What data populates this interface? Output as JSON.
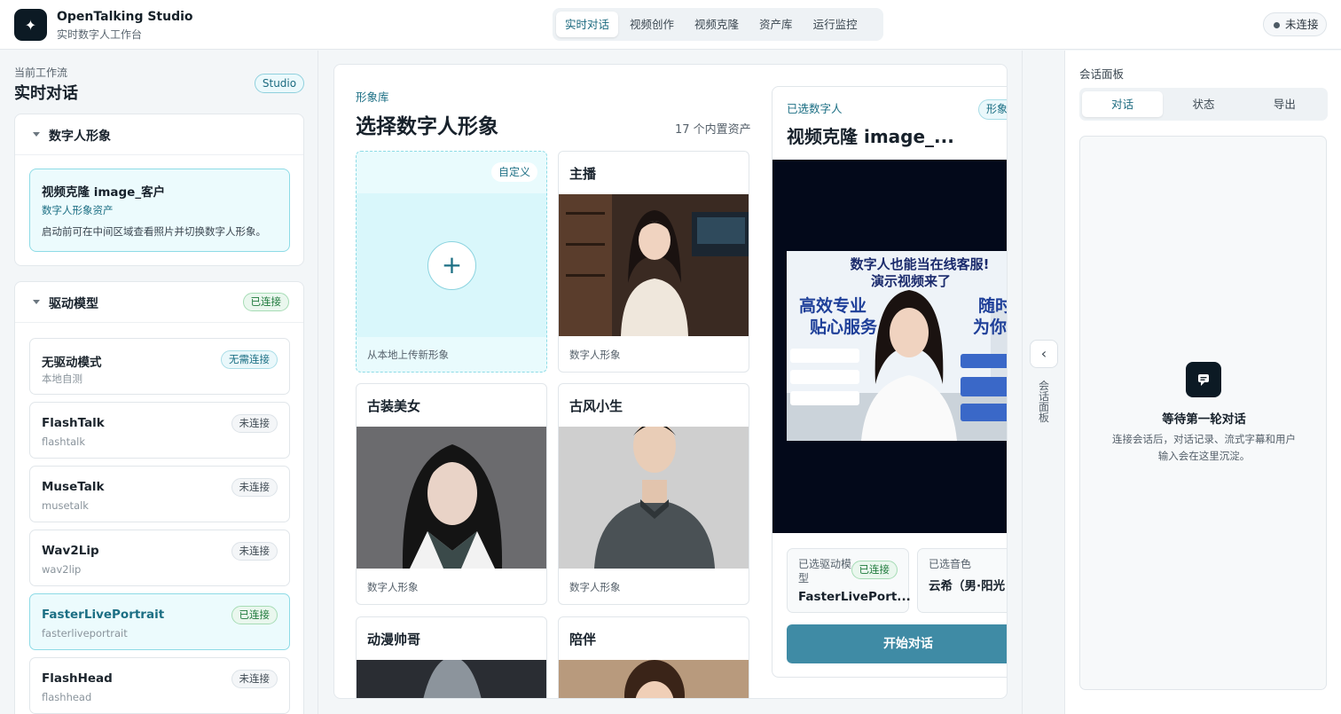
{
  "header": {
    "app_title": "OpenTalking Studio",
    "app_subtitle": "实时数字人工作台",
    "nav": [
      "实时对话",
      "视频创作",
      "视频克隆",
      "资产库",
      "运行监控"
    ],
    "active_nav": "实时对话",
    "connection_status": "未连接"
  },
  "left_panel": {
    "workflow_label": "当前工作流",
    "workflow_title": "实时对话",
    "workflow_badge": "Studio",
    "avatar_section": {
      "title": "数字人形象",
      "selected_name": "视频克隆 image_客户",
      "selected_type": "数字人形象资产",
      "selected_desc": "启动前可在中间区域查看照片并切换数字人形象。"
    },
    "model_section": {
      "title": "驱动模型",
      "status": "已连接",
      "models": [
        {
          "name": "无驱动模式",
          "id": "本地自测",
          "status": "无需连接"
        },
        {
          "name": "FlashTalk",
          "id": "flashtalk",
          "status": "未连接"
        },
        {
          "name": "MuseTalk",
          "id": "musetalk",
          "status": "未连接"
        },
        {
          "name": "Wav2Lip",
          "id": "wav2lip",
          "status": "未连接"
        },
        {
          "name": "FasterLivePortrait",
          "id": "fasterliveportrait",
          "status": "已连接"
        },
        {
          "name": "FlashHead",
          "id": "flashhead",
          "status": "未连接"
        }
      ]
    }
  },
  "library": {
    "label": "形象库",
    "title": "选择数字人形象",
    "count": "17 个内置资产",
    "upload_tag": "自定义",
    "upload_label": "从本地上传新形象",
    "avatars": [
      {
        "name": "主播",
        "type": "数字人形象"
      },
      {
        "name": "古装美女",
        "type": "数字人形象"
      },
      {
        "name": "古风小生",
        "type": "数字人形象"
      },
      {
        "name": "动漫帅哥",
        "type": ""
      },
      {
        "name": "陪伴",
        "type": ""
      }
    ]
  },
  "preview": {
    "label": "已选数字人",
    "title": "视频克隆 image_...",
    "tag": "形象",
    "thumb_headline_1": "数字人也能当在线客服!",
    "thumb_headline_2": "演示视频来了",
    "thumb_left_1": "高效专业",
    "thumb_left_2": "贴心服务",
    "thumb_right_1": "随时在线",
    "thumb_right_2": "为你解",
    "model_label": "已选驱动模型",
    "model_value": "FasterLivePort...",
    "model_status": "已连接",
    "voice_label": "已选音色",
    "voice_value": "云希（男·阳光",
    "start_button": "开始对话"
  },
  "side_toggle_label": "会话面板",
  "right_panel": {
    "label": "会话面板",
    "tabs": [
      "对话",
      "状态",
      "导出"
    ],
    "active_tab": "对话",
    "empty_title": "等待第一轮对话",
    "empty_desc": "连接会话后，对话记录、流式字幕和用户输入会在这里沉淀。"
  }
}
